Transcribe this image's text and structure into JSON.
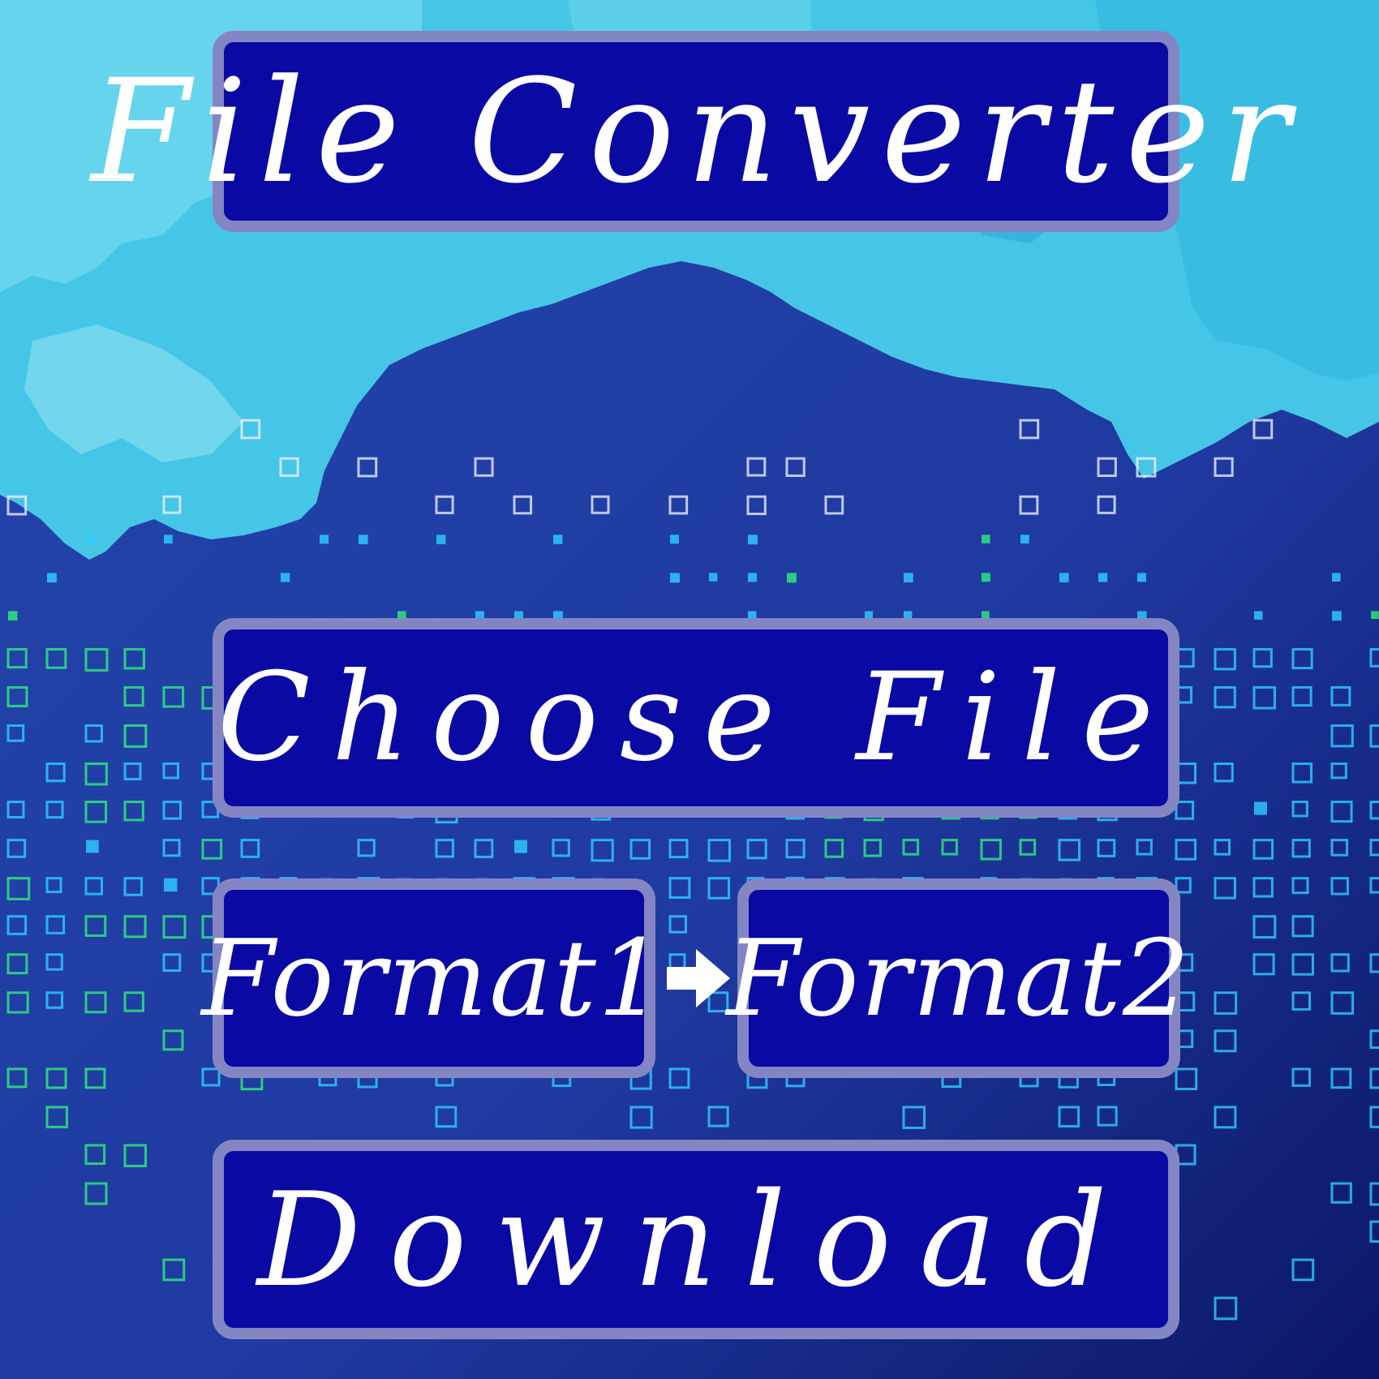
{
  "app": {
    "title": "File Converter"
  },
  "actions": {
    "choose_file_label": "Choose File",
    "download_label": "Download"
  },
  "formats": {
    "source": "Format1",
    "target": "Format2"
  },
  "icons": {
    "convert_arrow": "right-arrow-icon"
  },
  "colors": {
    "panel_fill": "#0a09a3",
    "panel_border": "#8486c4",
    "text": "#ffffff",
    "sky_light": "#5fd4ee",
    "sky_mid": "#2cb8e4",
    "pixel_white": "#e8ecff",
    "pixel_cyan": "#2fd0ff",
    "pixel_green": "#2ef07a"
  }
}
